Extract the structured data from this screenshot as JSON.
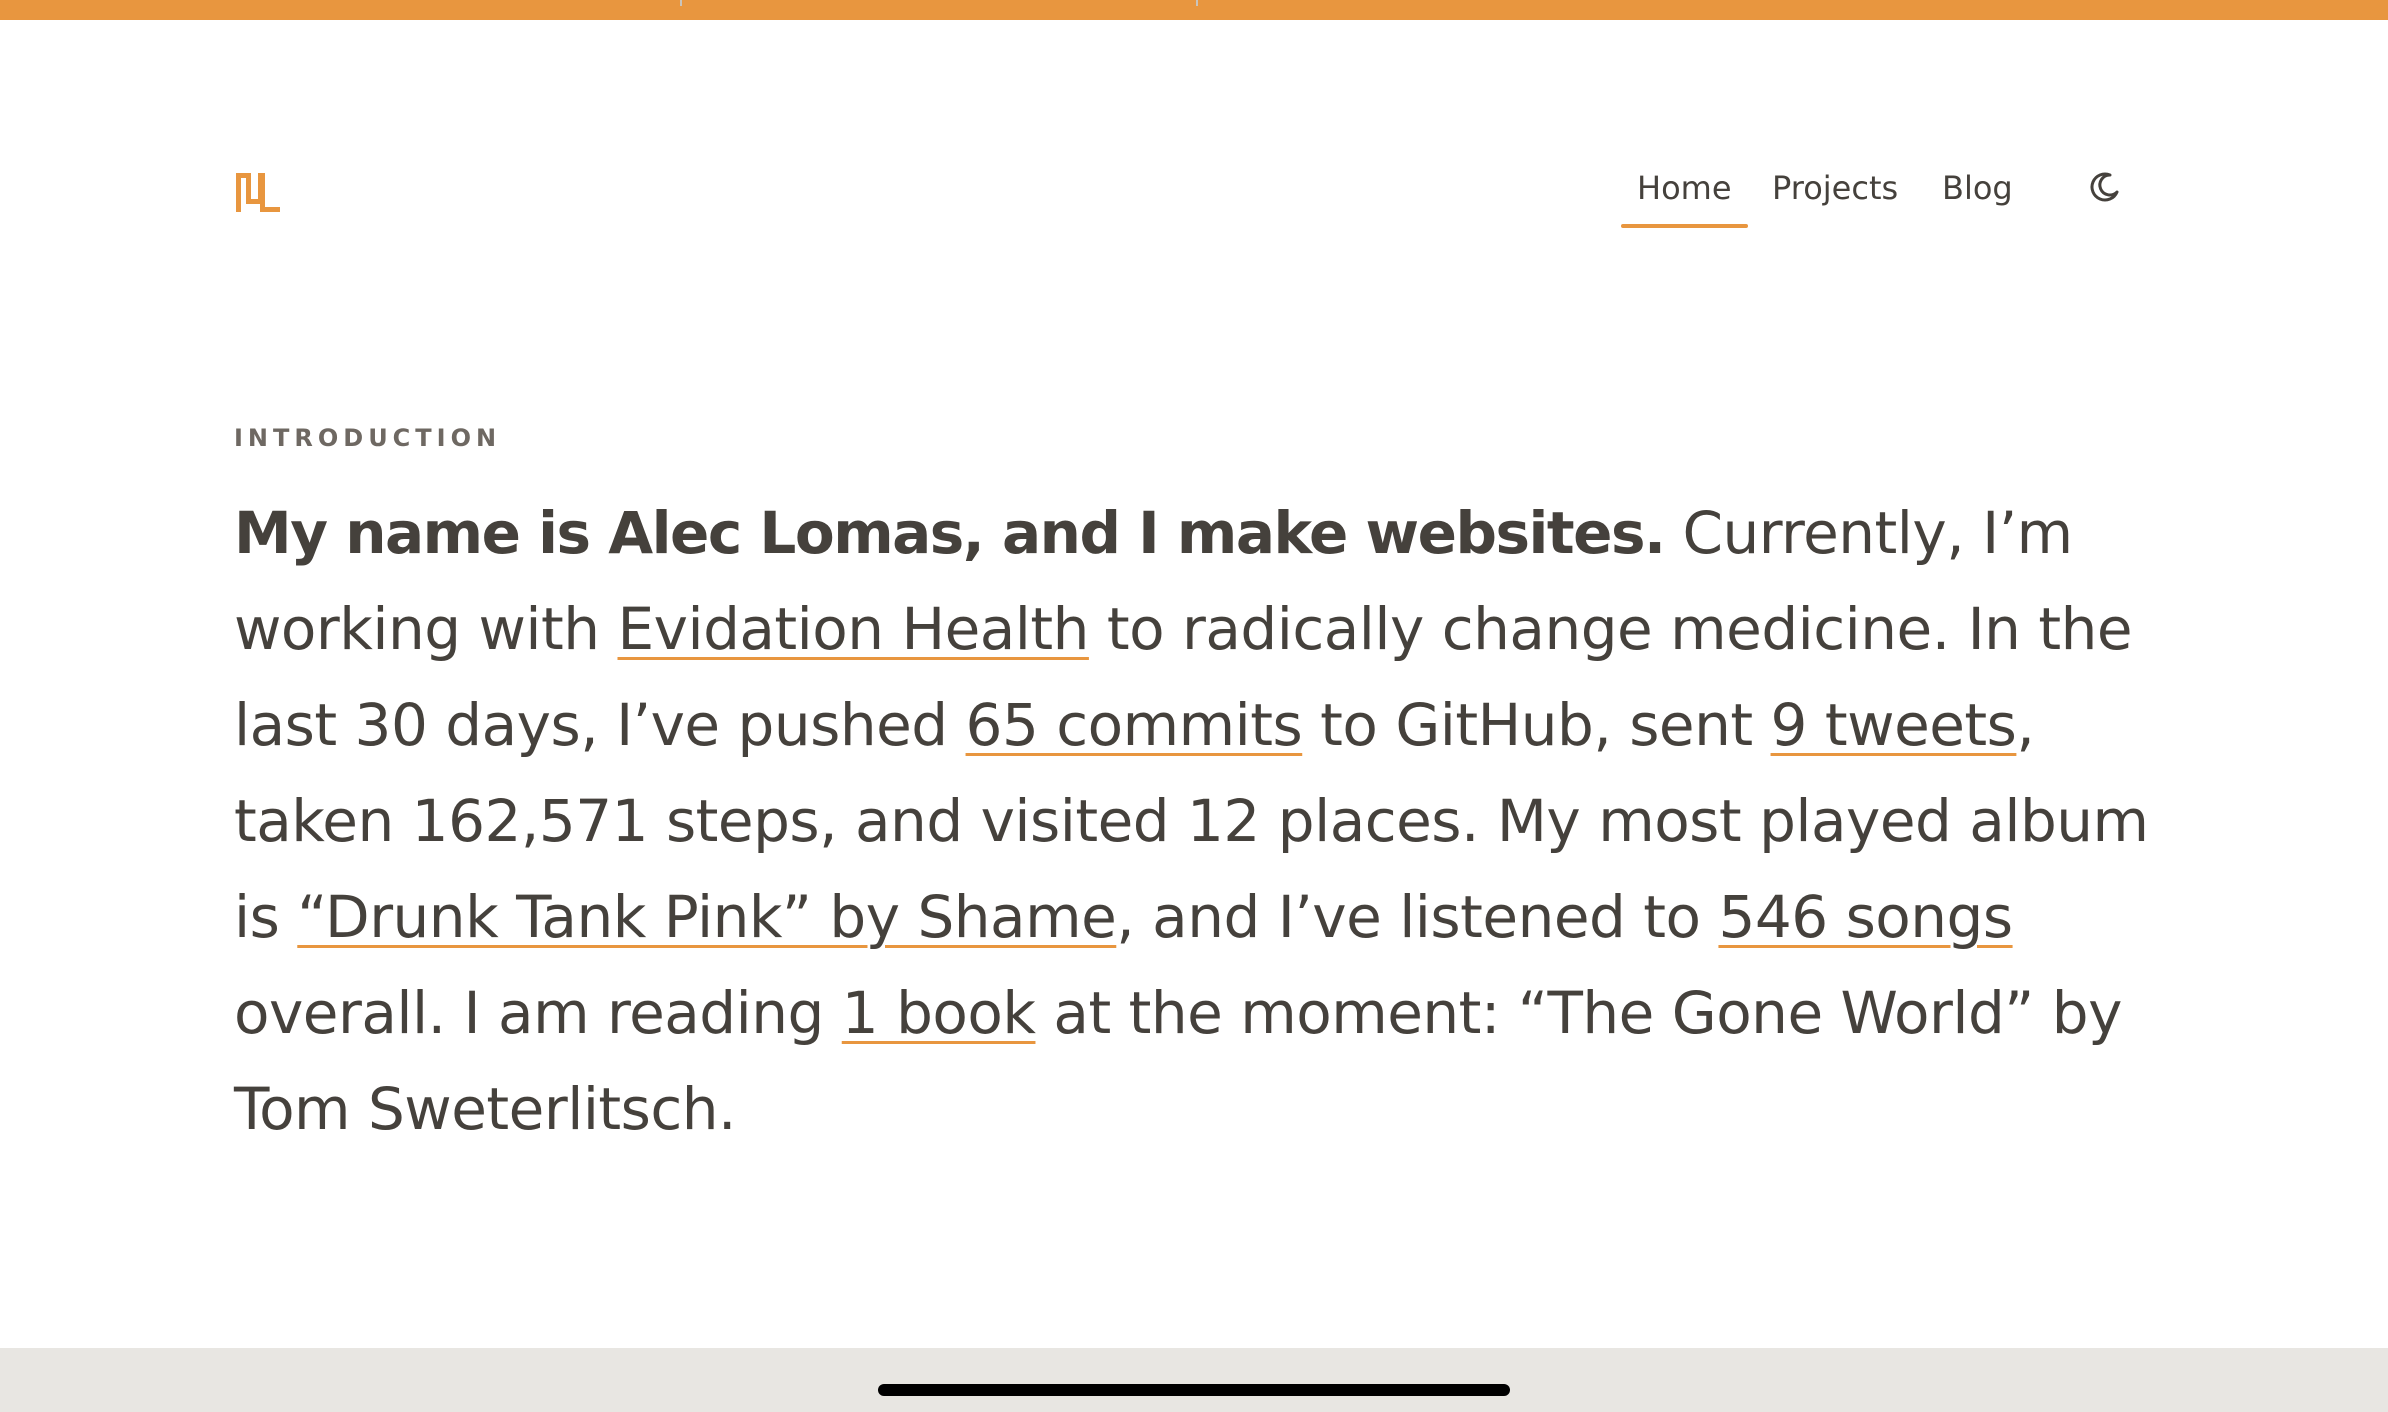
{
  "brand": {
    "logo_icon": "nl-monogram-icon",
    "accent_color": "#e8963f",
    "text_color": "#45413c"
  },
  "nav": {
    "items": [
      {
        "label": "Home",
        "active": true
      },
      {
        "label": "Projects",
        "active": false
      },
      {
        "label": "Blog",
        "active": false
      }
    ],
    "theme_toggle_icon": "moon-icon"
  },
  "intro": {
    "eyebrow": "INTRODUCTION",
    "headline": "My name is Alec Lomas, and I make websites.",
    "p1": " Currently, I’m working with ",
    "link_employer": "Evidation Health",
    "p2": " to radically change medicine. In the last 30 days, I’ve pushed ",
    "link_commits": "65 commits",
    "p3": " to GitHub, sent ",
    "link_tweets": "9 tweets",
    "p4": ", taken 162,571 steps, and visited 12 places. My most played album is ",
    "link_album": "“Drunk Tank Pink” by Shame",
    "p5": ", and I’ve listened to ",
    "link_songs": "546 songs",
    "p6": " overall. I am reading ",
    "link_books": "1 book",
    "p7": " at the moment: “The Gone World” by Tom Sweterlitsch."
  }
}
